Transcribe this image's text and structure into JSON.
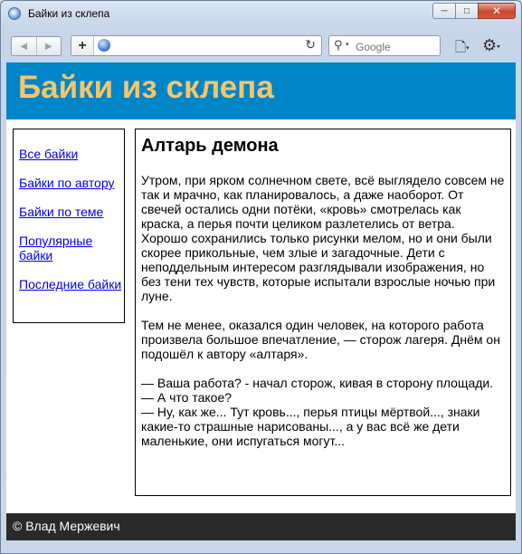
{
  "window": {
    "title": "Байки из склепа",
    "controls": {
      "minimize": "─",
      "maximize": "□",
      "close": "✕"
    }
  },
  "toolbar": {
    "back_icon": "◀",
    "forward_icon": "▶",
    "add_icon": "+",
    "url_value": "",
    "refresh_icon": "↻",
    "search_placeholder": "Google",
    "search_icon": "⚲",
    "page_icon": "🗋",
    "tools_icon": "⚙",
    "caret": "▾"
  },
  "site": {
    "title": "Байки из склепа",
    "nav": [
      {
        "label": "Все байки"
      },
      {
        "label": "Байки по автору"
      },
      {
        "label": "Байки по теме"
      },
      {
        "label": "Популярные байки"
      },
      {
        "label": "Последние байки"
      }
    ],
    "article": {
      "heading": "Алтарь демона",
      "paragraphs": [
        "Утром, при ярком солнечном свете, всё выглядело совсем не так и мрачно, как планировалось, а даже наоборот. От свечей остались одни потёки, «кровь» смотрелась как краска, а перья почти целиком разлетелись от ветра. Хорошо сохранились только рисунки мелом, но и они были скорее прикольные, чем злые и загадочные. Дети с неподдельным интересом разглядывали изображения, но без тени тех чувств, которые испытали взрослые ночью при луне.",
        "Тем не менее, оказался один человек, на которого работа произвела большое впечатление, — сторож лагеря. Днём он подошёл к автору «алтаря»."
      ],
      "dialog": [
        "— Ваша работа? - начал сторож, кивая в сторону площади.",
        "— А что такое?",
        "— Ну, как же... Тут кровь..., перья птицы мёртвой..., знаки какие-то страшные нарисованы..., а у вас всё же дети маленькие, они испугаться могут..."
      ]
    },
    "footer": "© Влад Мержевич"
  }
}
